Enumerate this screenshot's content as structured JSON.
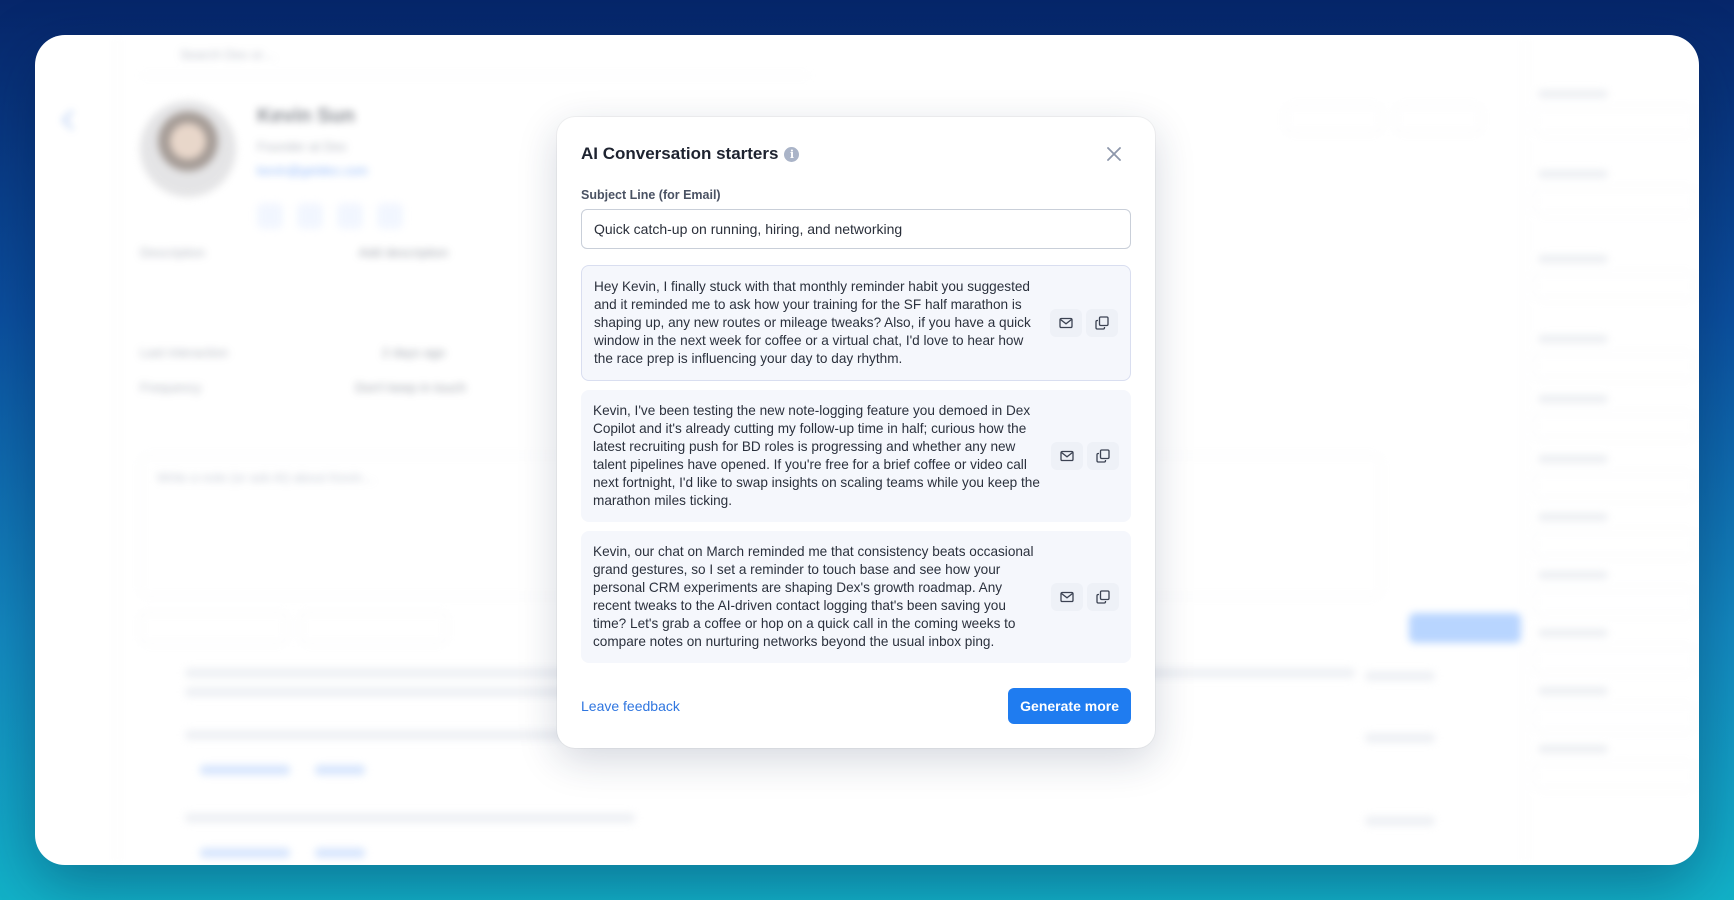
{
  "background": {
    "search_placeholder": "Search Dex or…",
    "contact_name": "Kevin Sun",
    "contact_title": "Founder at Dex",
    "contact_email": "kevin@getdex.com",
    "description_label": "Description",
    "description_value": "Add description",
    "last_interaction_label": "Last interaction",
    "last_interaction_value": "2 days ago",
    "frequency_label": "Frequency",
    "frequency_value": "Don't keep in touch",
    "note_placeholder": "Write a note (or ask AI) about Kevin…",
    "colors": {
      "primary": "#1f7cf0"
    }
  },
  "modal": {
    "title": "AI Conversation starters",
    "info_icon": "info-icon",
    "close_icon": "close-icon",
    "subject_label": "Subject Line (for Email)",
    "subject_value": "Quick catch-up on running, hiring, and networking",
    "starters": [
      {
        "text": "Hey Kevin, I finally stuck with that monthly reminder habit you suggested and it reminded me to ask how your training for the SF half marathon is shaping up, any new routes or mileage tweaks? Also, if you have a quick window in the next week for coffee or a virtual chat, I'd love to hear how the race prep is influencing your day to day rhythm."
      },
      {
        "text": "Kevin, I've been testing the new note-logging feature you demoed in Dex Copilot and it's already cutting my follow-up time in half; curious how the latest recruiting push for BD roles is progressing and whether any new talent pipelines have opened. If you're free for a brief coffee or video call next fortnight, I'd like to swap insights on scaling teams while you keep the marathon miles ticking."
      },
      {
        "text": "Kevin, our chat on March reminded me that consistency beats occasional grand gestures, so I set a reminder to touch base and see how your personal CRM experiments are shaping Dex's growth roadmap. Any recent tweaks to the AI-driven contact logging that's been saving you time? Let's grab a coffee or hop on a quick call in the coming weeks to compare notes on nurturing networks beyond the usual inbox ping."
      }
    ],
    "email_icon": "mail-icon",
    "copy_icon": "copy-icon",
    "feedback_label": "Leave feedback",
    "generate_label": "Generate more"
  }
}
